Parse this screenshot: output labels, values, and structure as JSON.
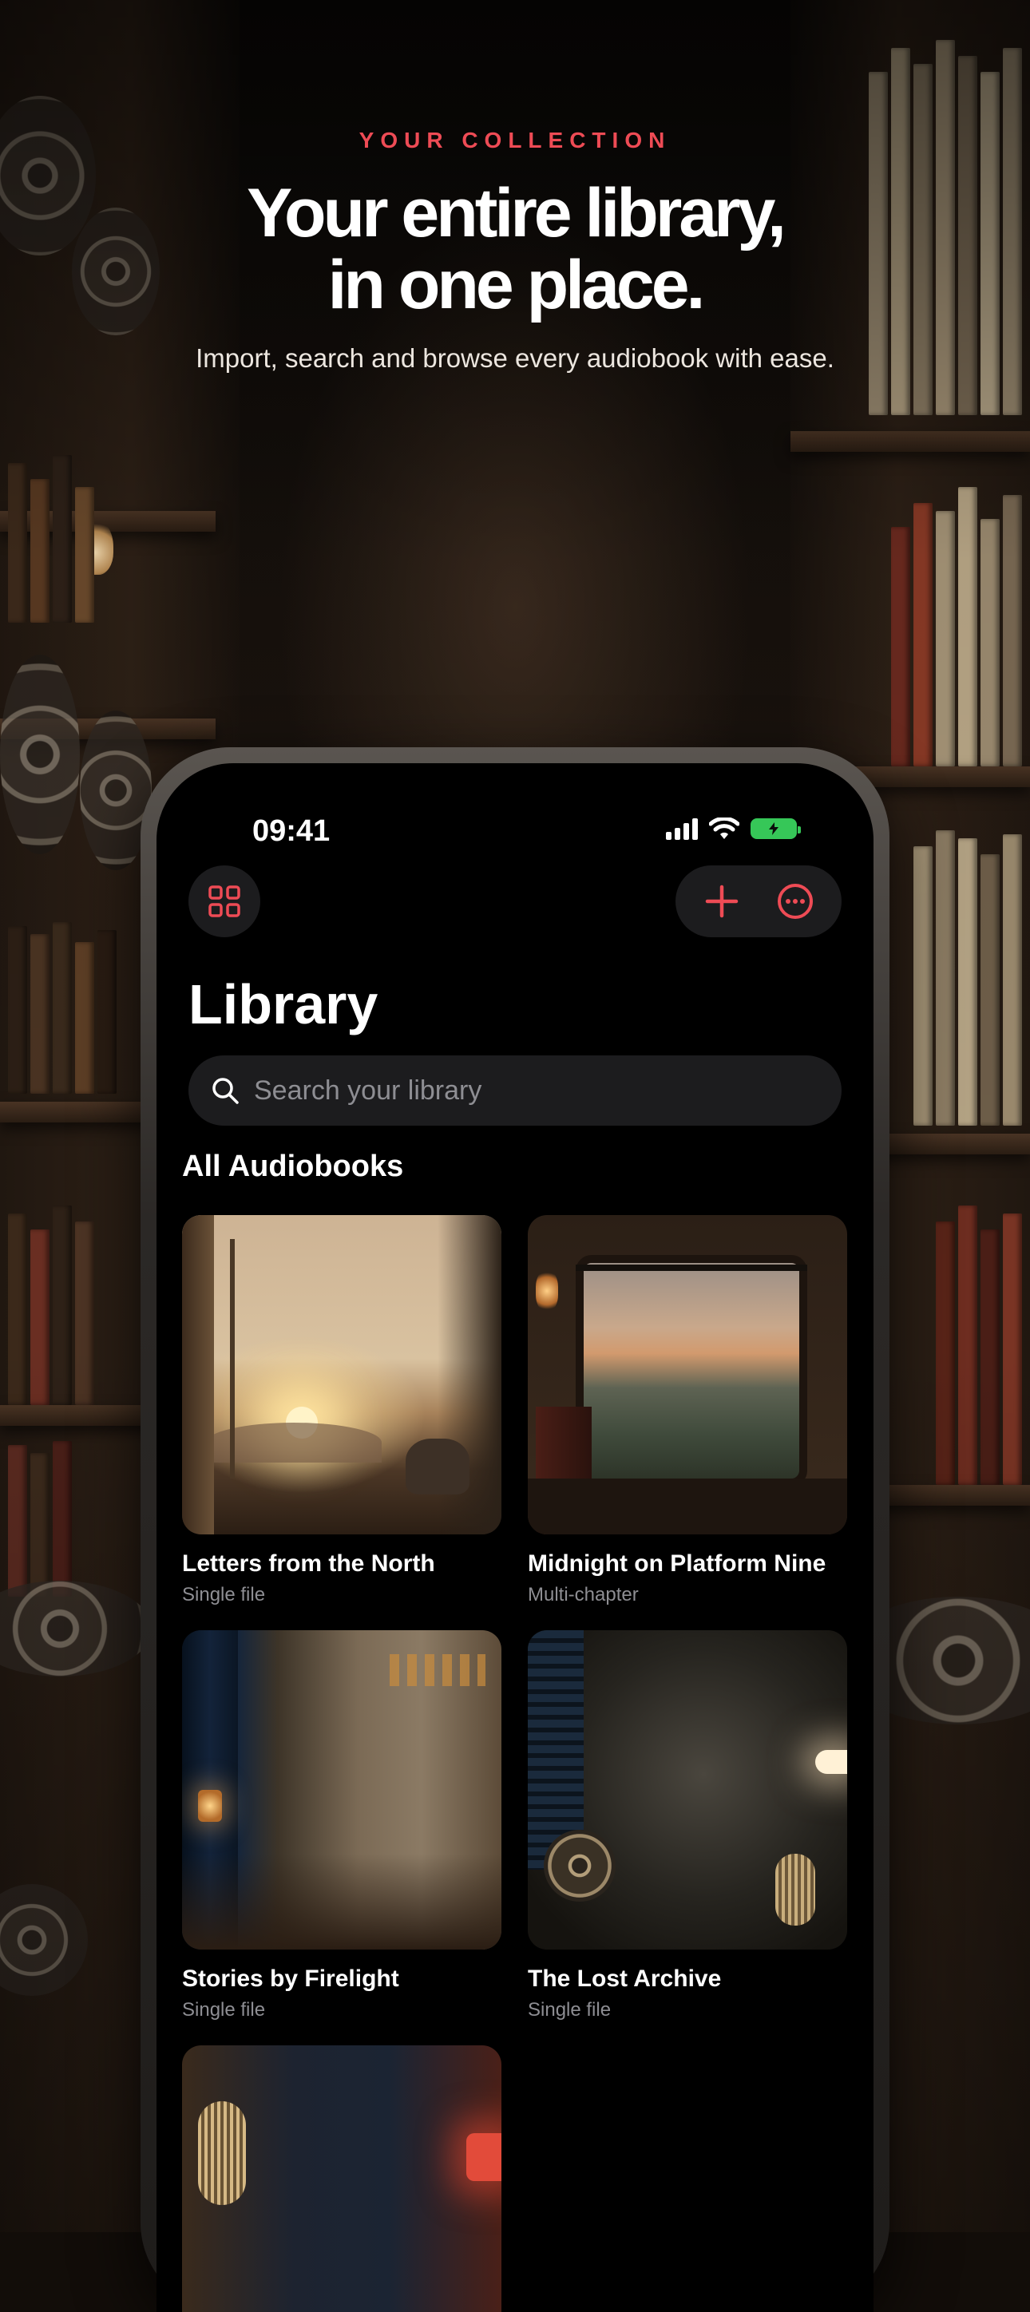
{
  "hero": {
    "eyebrow": "YOUR COLLECTION",
    "headline_line1": "Your entire library,",
    "headline_line2": "in one place.",
    "subline": "Import, search and browse every audiobook with ease."
  },
  "status_bar": {
    "time": "09:41",
    "battery_color": "#36c758"
  },
  "toolbar": {
    "accent_color": "#ee4b55",
    "left_icon": "grid-icon",
    "add_icon": "plus-icon",
    "more_icon": "ellipsis-circle-icon"
  },
  "library": {
    "title": "Library",
    "search_placeholder": "Search your library",
    "section_title": "All Audiobooks",
    "books": [
      {
        "title": "Letters from the North",
        "subtitle": "Single file"
      },
      {
        "title": "Midnight on Platform Nine",
        "subtitle": "Multi-chapter"
      },
      {
        "title": "Stories by Firelight",
        "subtitle": "Single file"
      },
      {
        "title": "The Lost Archive",
        "subtitle": "Single file"
      },
      {
        "title": "",
        "subtitle": ""
      }
    ]
  }
}
